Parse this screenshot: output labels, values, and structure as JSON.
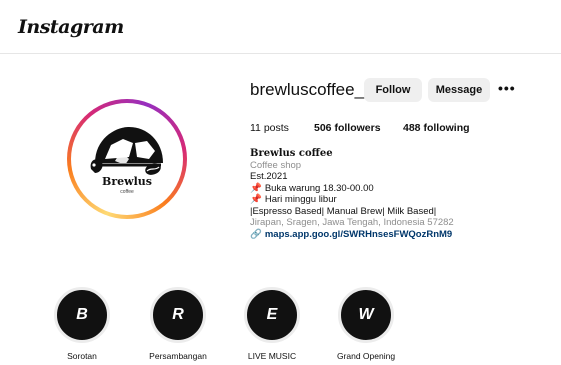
{
  "header": {
    "logo_text": "Instagram"
  },
  "profile": {
    "username": "brewluscoffee_",
    "follow_label": "Follow",
    "message_label": "Message",
    "more_label": "•••",
    "avatar_text": "Brewlus",
    "avatar_subtext": "coffee"
  },
  "stats": {
    "posts_count": "11",
    "posts_label": "posts",
    "followers_count": "506",
    "followers_label": "followers",
    "following_count": "488",
    "following_label": "following"
  },
  "bio": {
    "name": "Brewlus coffee",
    "category": "Coffee shop",
    "lines": [
      "Est.2021",
      "Buka warung 18.30-00.00",
      "Hari minggu libur",
      "|Espresso Based| Manual Brew| Milk Based|"
    ],
    "address": "Jirapan, Sragen, Jawa Tengah, Indonesia 57282",
    "link": "maps.app.goo.gl/SWRHnsesFWQozRnM9"
  },
  "highlights": [
    {
      "letter": "B",
      "label": "Sorotan"
    },
    {
      "letter": "R",
      "label": "Persambangan"
    },
    {
      "letter": "E",
      "label": "LIVE MUSIC"
    },
    {
      "letter": "W",
      "label": "Grand Opening"
    }
  ],
  "colors": {
    "link": "#00376b",
    "button_bg": "#efefef",
    "muted": "#8e8e8e"
  },
  "icons": [
    "pushpin-icon",
    "link-icon",
    "more-options-icon"
  ]
}
